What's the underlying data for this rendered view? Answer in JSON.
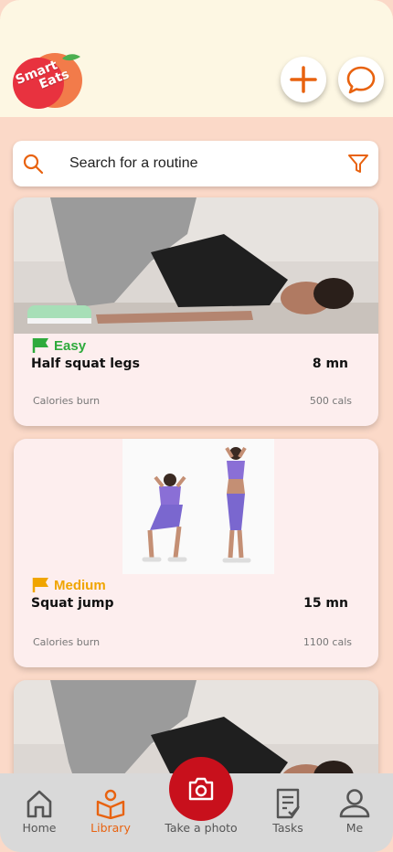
{
  "brand": {
    "logo_line1": "Smart",
    "logo_line2": "Eats",
    "accent": "#e8620f",
    "logo_red": "#e8323f"
  },
  "header": {
    "add_icon": "plus-icon",
    "chat_icon": "chat-bubble-icon"
  },
  "search": {
    "placeholder": "Search for a routine",
    "search_icon": "search-icon",
    "filter_icon": "filter-icon"
  },
  "routines": [
    {
      "level": "Easy",
      "level_color": "#2eaa3c",
      "name": "Half squat legs",
      "duration": "8 mn",
      "calories_label": "Calories burn",
      "calories_value": "500 cals"
    },
    {
      "level": "Medium",
      "level_color": "#f0a500",
      "name": "Squat jump",
      "duration": "15 mn",
      "calories_label": "Calories burn",
      "calories_value": "1100 cals"
    }
  ],
  "tabs": [
    {
      "label": "Home",
      "icon": "home-icon",
      "active": false
    },
    {
      "label": "Library",
      "icon": "library-icon",
      "active": true
    },
    {
      "label": "Take a photo",
      "icon": "camera-icon",
      "active": false
    },
    {
      "label": "Tasks",
      "icon": "tasks-icon",
      "active": false
    },
    {
      "label": "Me",
      "icon": "user-icon",
      "active": false
    }
  ]
}
